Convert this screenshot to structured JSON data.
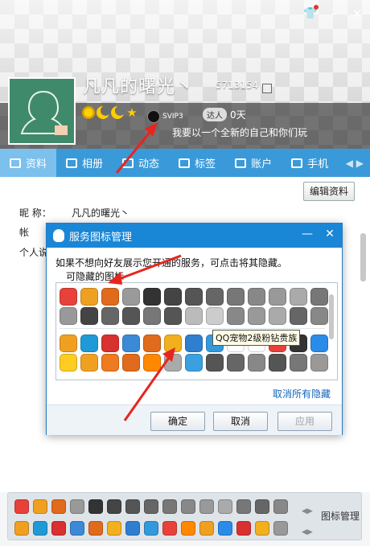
{
  "header": {
    "nickname": "凡凡的曙光丶",
    "qq_number": "5713154",
    "svip": "SVIP3",
    "daren_label": "达人",
    "daren_days": "0天",
    "signature": "我要以一个全新的自己和你们玩"
  },
  "tabs": [
    {
      "label": "资料",
      "icon": "profile-card-icon"
    },
    {
      "label": "相册",
      "icon": "photo-icon"
    },
    {
      "label": "动态",
      "icon": "feed-icon"
    },
    {
      "label": "标签",
      "icon": "tag-icon"
    },
    {
      "label": "账户",
      "icon": "wallet-icon"
    },
    {
      "label": "手机",
      "icon": "phone-icon"
    }
  ],
  "profile": {
    "edit_button": "编辑资料",
    "nick_label": "昵    称：",
    "nick_value": "凡凡的曙光丶",
    "account_label": "帐",
    "intro_label": "个人说"
  },
  "dialog": {
    "title": "服务图标管理",
    "description": "如果不想向好友展示您开通的服务，可点击将其隐藏。",
    "subtitle": "可隐藏的图标",
    "tooltip": "QQ宠物2级粉钻贵族",
    "cancel_all": "取消所有隐藏",
    "ok": "确定",
    "cancel": "取消",
    "apply": "应用"
  },
  "bottom": {
    "icon_manager": "图标管理"
  },
  "colors": {
    "accent": "#1a86d6",
    "tab_bar": "#3a9ad9",
    "arrow": "#e8241e"
  },
  "icon_colors_row_a": [
    "#e8413a",
    "#f0a020",
    "#e06b1c",
    "#9a9a9a",
    "#333333",
    "#444444",
    "#555555",
    "#666666",
    "#777777",
    "#888888",
    "#999999",
    "#aaaaaa",
    "#777777"
  ],
  "icon_colors_row_b": [
    "#999999",
    "#444444",
    "#666666",
    "#555555",
    "#777777",
    "#555555",
    "#bbbbbb",
    "#cccccc",
    "#888888",
    "#999999",
    "#aaaaaa",
    "#666666",
    "#888888"
  ],
  "icon_colors_row_c": [
    "#f0a020",
    "#1f9ad6",
    "#d93030",
    "#3b8ad8",
    "#e06b1c",
    "#f2b01e",
    "#2f7fd0",
    "#3399dd",
    "#ffffff",
    "#ffffff",
    "#e8413a",
    "#333333",
    "#2b8be8"
  ],
  "icon_colors_row_d": [
    "#ffcc22",
    "#f0a020",
    "#f07a20",
    "#e06b1c",
    "#ff8800",
    "#aaaaaa",
    "#3aa0e0",
    "#555555",
    "#666666",
    "#888888",
    "#555555",
    "#777777",
    "#999999"
  ],
  "bottom_colors_row_1": [
    "#e8413a",
    "#f0a020",
    "#e06b1c",
    "#999999",
    "#333333",
    "#444444",
    "#555555",
    "#666666",
    "#777777",
    "#888888",
    "#999999",
    "#aaaaaa",
    "#777777",
    "#666666",
    "#888888"
  ],
  "bottom_colors_row_2": [
    "#f0a020",
    "#1f9ad6",
    "#d93030",
    "#3b8ad8",
    "#e06b1c",
    "#f2b01e",
    "#2f7fd0",
    "#3399dd",
    "#e8413a",
    "#ff8800",
    "#f0a020",
    "#2b8be8",
    "#d93030",
    "#f2b01e",
    "#999999"
  ]
}
